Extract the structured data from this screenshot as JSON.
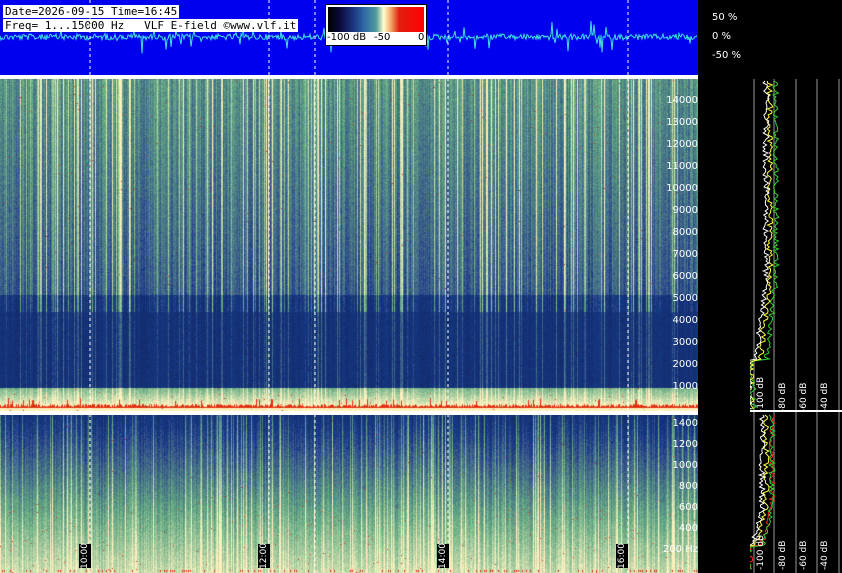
{
  "header": {
    "date_line": "Date=2026-09-15 Time=16:45",
    "freq_line": "Freq= 1...15000 Hz   VLF E-field ©www.vlf.it"
  },
  "colorbar": {
    "labels": [
      "-100 dB",
      "-50",
      "0"
    ]
  },
  "waveform": {
    "percent_labels": [
      "50 %",
      "0 %",
      "-50 %"
    ]
  },
  "upper_spectrogram": {
    "freq_labels": [
      "14000",
      "13000",
      "12000",
      "11000",
      "10000",
      "9000",
      "8000",
      "7000",
      "6000",
      "5000",
      "4000",
      "3000",
      "2000",
      "1000"
    ]
  },
  "lower_spectrogram": {
    "freq_labels": [
      "1400",
      "1200",
      "1000",
      "800",
      "600",
      "400",
      "200 Hz"
    ]
  },
  "time_labels": [
    "10:00",
    "12:00",
    "14:00",
    "16:00"
  ],
  "spectrum_panel": {
    "db_labels_upper": [
      "-100 dB",
      "-80 dB",
      "-60 dB",
      "-40 dB",
      "-20 dB"
    ],
    "db_labels_lower": [
      "-100 dB",
      "-80 dB",
      "-60 dB",
      "-40 dB",
      "-20 dB"
    ]
  },
  "colors": {
    "waveform_bg": "#0000ee",
    "waveform_trace": "#40e0e0",
    "spectrogram_dark": "#1b2b66",
    "spectrogram_light": "#7fc8a0",
    "hot": "#e03010",
    "baseline_band": "#fff2c0",
    "spectrum_white": "#ffffff",
    "spectrum_yellow": "#ffff40",
    "spectrum_green": "#30d030",
    "spectrum_red": "#ff2020"
  }
}
